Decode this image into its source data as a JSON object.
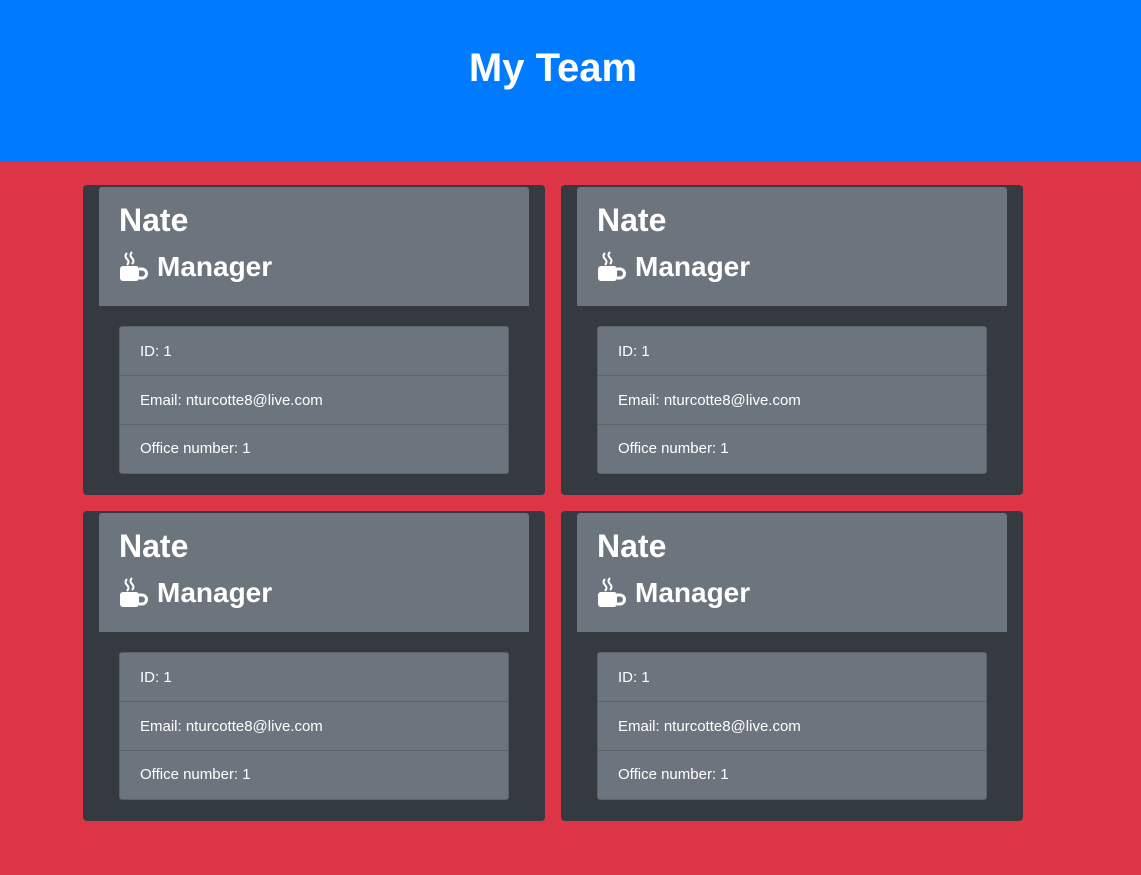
{
  "page": {
    "title": "My Team",
    "colors": {
      "header": "#007bff",
      "background": "#dc3545",
      "card": "#343a40",
      "panel": "#6c757d"
    }
  },
  "cards": [
    {
      "name": "Nate",
      "role": "Manager",
      "role_icon": "coffee-mug-icon",
      "id": "ID: 1",
      "email": "Email: nturcotte8@live.com",
      "office": "Office number: 1"
    },
    {
      "name": "Nate",
      "role": "Manager",
      "role_icon": "coffee-mug-icon",
      "id": "ID: 1",
      "email": "Email: nturcotte8@live.com",
      "office": "Office number: 1"
    },
    {
      "name": "Nate",
      "role": "Manager",
      "role_icon": "coffee-mug-icon",
      "id": "ID: 1",
      "email": "Email: nturcotte8@live.com",
      "office": "Office number: 1"
    },
    {
      "name": "Nate",
      "role": "Manager",
      "role_icon": "coffee-mug-icon",
      "id": "ID: 1",
      "email": "Email: nturcotte8@live.com",
      "office": "Office number: 1"
    }
  ]
}
